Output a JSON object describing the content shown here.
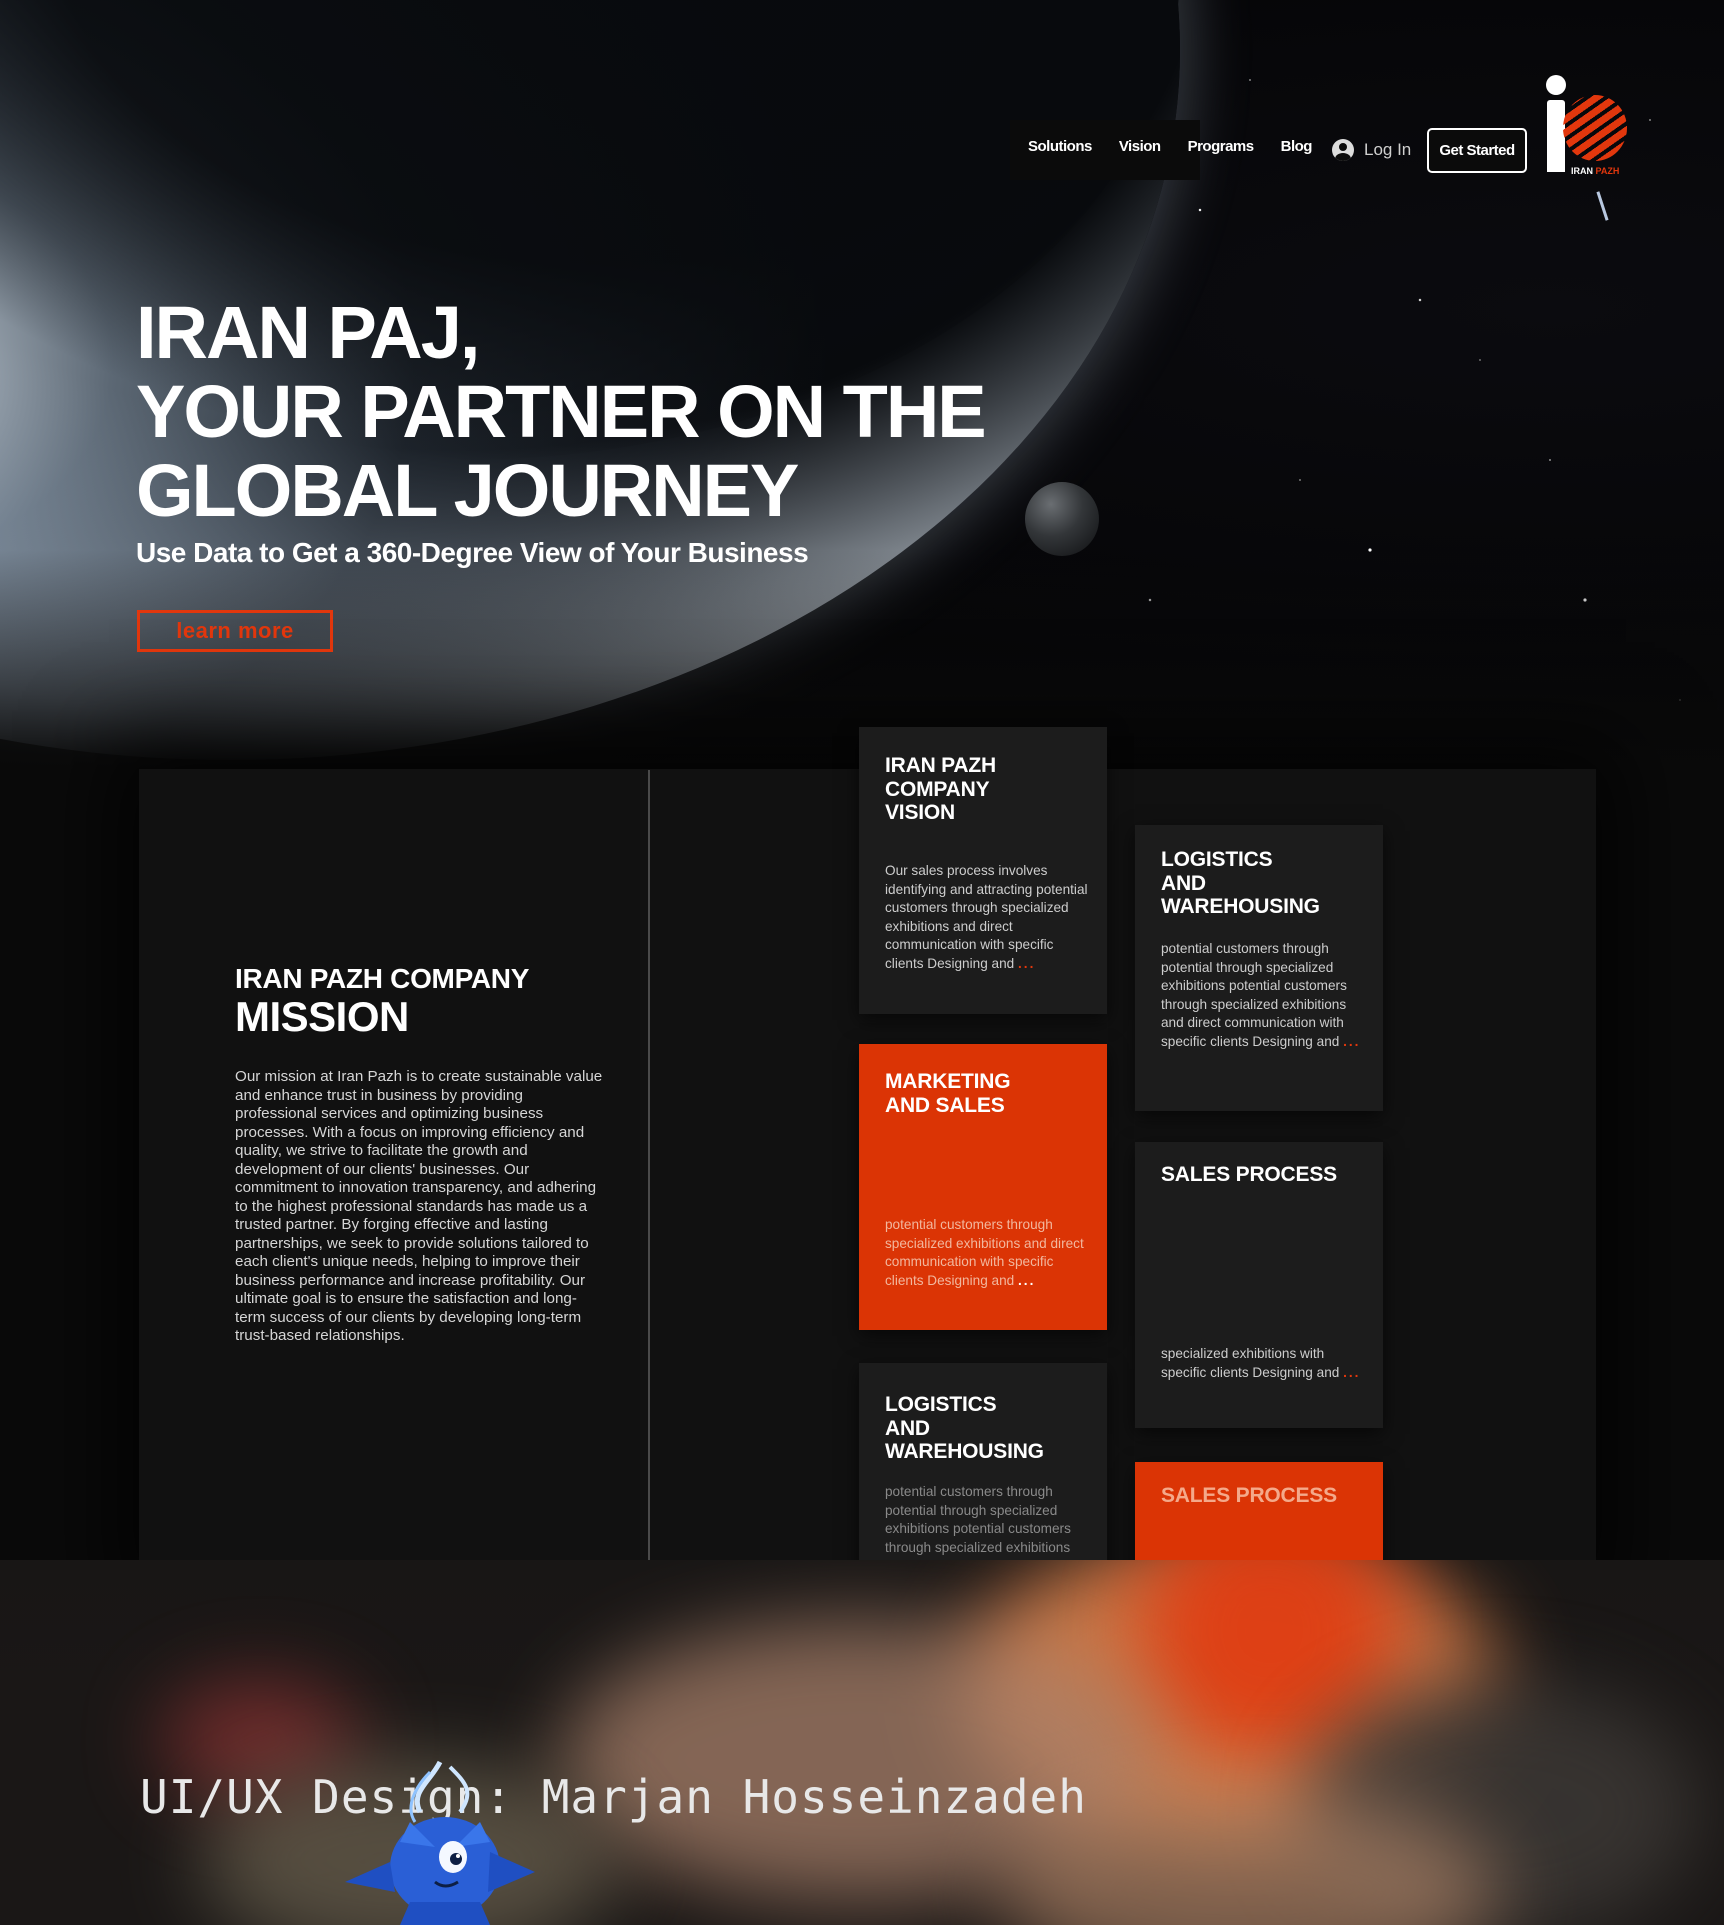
{
  "nav": {
    "links": [
      "Solutions",
      "Vision",
      "Programs",
      "Blog"
    ],
    "login": "Log In",
    "cta": "Get Started"
  },
  "logo": {
    "word1": "IRAN",
    "word2": "PAZH"
  },
  "hero": {
    "title_lines": [
      "IRAN PAJ,",
      "YOUR PARTNER ON THE",
      "GLOBAL JOURNEY"
    ],
    "subtitle": "Use Data to Get a 360-Degree View of Your Business",
    "button": "learn more"
  },
  "mission": {
    "title_small": "IRAN PAZH COMPANY",
    "title_big": "MISSION",
    "body": "Our mission at Iran Pazh is to create sustainable value and enhance trust in business by providing professional services and optimizing business processes. With a focus on improving efficiency and quality, we strive to facilitate the growth and development of our clients' businesses. Our commitment to innovation transparency, and adhering to the highest professional standards has made us a trusted partner. By forging effective and lasting partnerships, we seek to provide solutions tailored to each client's unique needs, helping to improve their business performance and increase profitability. Our ultimate goal is to ensure the satisfaction and long-term success of our clients by developing long-term trust-based relationships."
  },
  "cards": {
    "vision": {
      "title": "IRAN PAZH\nCOMPANY\nVISION",
      "body": "Our sales process involves identifying and attracting potential customers through specialized exhibitions and direct communication with specific clients Designing and",
      "dots": "..."
    },
    "logistics1": {
      "title": "LOGISTICS\nAND\nWAREHOUSING",
      "body": "potential customers through potential through specialized exhibitions potential customers through specialized exhibitions and direct communication with specific clients Designing and",
      "dots": "..."
    },
    "marketing": {
      "title": "MARKETING\nAND SALES",
      "body": "potential customers through specialized exhibitions and direct communication with specific clients Designing and",
      "dots": "..."
    },
    "sales1": {
      "title": "SALES PROCESS",
      "body": "specialized exhibitions with specific clients Designing and",
      "dots": "..."
    },
    "logistics2": {
      "title": "LOGISTICS\nAND\nWAREHOUSING",
      "body": "potential customers through potential through specialized exhibitions potential customers through specialized exhibitions and direct communication with specific clients Designing and"
    },
    "sales2": {
      "title": "SALES PROCESS"
    }
  },
  "footer": {
    "credit": "UI/UX Design:     Marjan Hosseinzadeh"
  },
  "colors": {
    "accent": "#db3405",
    "background": "#0a0a0a",
    "card": "#1c1c1c"
  },
  "icons": [
    "user-icon",
    "logo-mark",
    "mascot-illustration"
  ]
}
